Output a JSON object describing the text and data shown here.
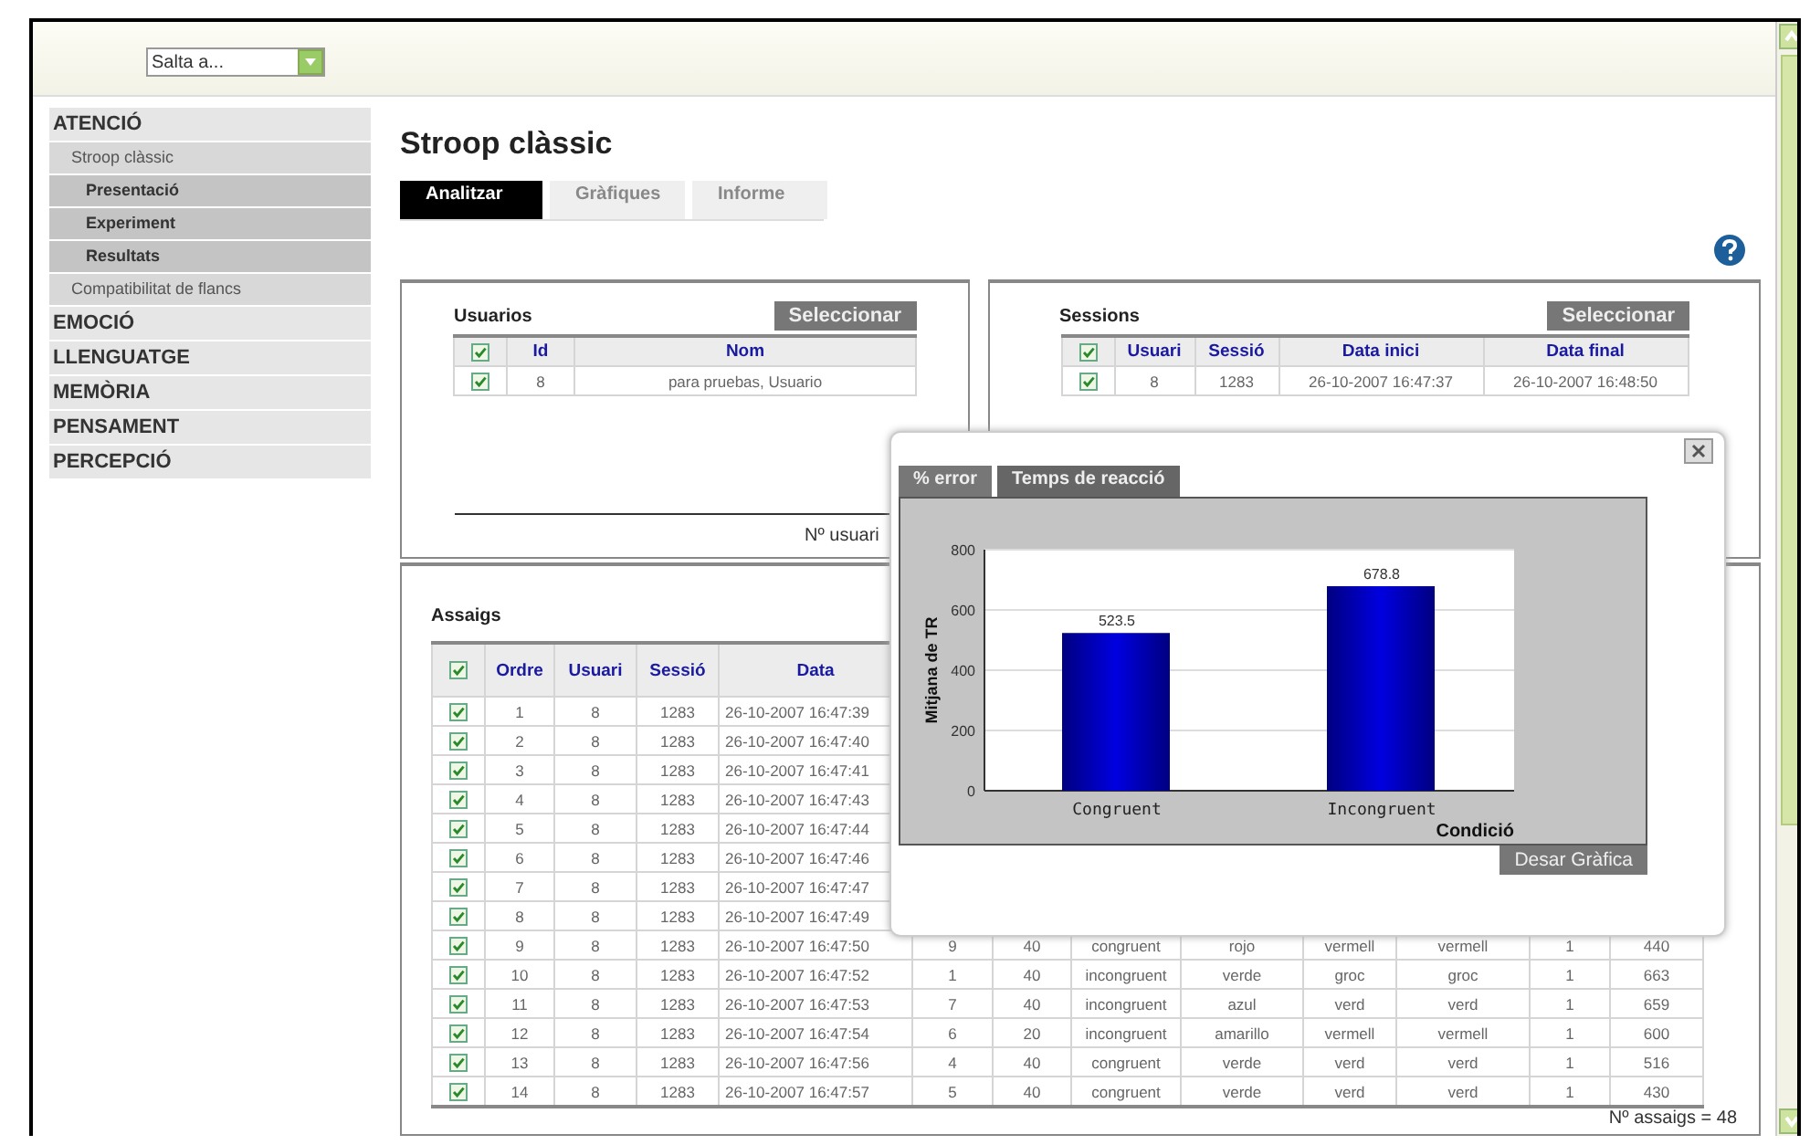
{
  "jump_select": {
    "value": "Salta a..."
  },
  "sidebar": {
    "items": [
      {
        "label": "ATENCIÓ",
        "children": [
          {
            "label": "Stroop clàssic",
            "children": [
              {
                "label": "Presentació"
              },
              {
                "label": "Experiment"
              },
              {
                "label": "Resultats"
              }
            ]
          },
          {
            "label": "Compatibilitat de flancs"
          }
        ]
      },
      {
        "label": "EMOCIÓ"
      },
      {
        "label": "LLENGUATGE"
      },
      {
        "label": "MEMÒRIA"
      },
      {
        "label": "PENSAMENT"
      },
      {
        "label": "PERCEPCIÓ"
      }
    ]
  },
  "page": {
    "title": "Stroop clàssic"
  },
  "tabs": [
    {
      "label": "Analitzar",
      "selected": true
    },
    {
      "label": "Gràfiques",
      "selected": false
    },
    {
      "label": "Informe",
      "selected": false
    }
  ],
  "users_panel": {
    "title": "Usuarios",
    "button": "Seleccionar",
    "header_checked": true,
    "columns": [
      "Id",
      "Nom"
    ],
    "rows": [
      {
        "checked": true,
        "cells": [
          "8",
          "para pruebas, Usuario"
        ]
      }
    ],
    "footer": "Nº usuari"
  },
  "sessions_panel": {
    "title": "Sessions",
    "button": "Seleccionar",
    "header_checked": true,
    "columns": [
      "Usuari",
      "Sessió",
      "Data inici",
      "Data final"
    ],
    "rows": [
      {
        "checked": true,
        "cells": [
          "8",
          "1283",
          "26-10-2007 16:47:37",
          "26-10-2007 16:48:50"
        ]
      }
    ]
  },
  "trials_panel": {
    "title": "Assaigs",
    "header_checked": true,
    "columns": [
      "Ordre",
      "Usuari",
      "Sessió",
      "Data"
    ],
    "rows": [
      {
        "checked": true,
        "cells": [
          "1",
          "8",
          "1283",
          "26-10-2007 16:47:39"
        ]
      },
      {
        "checked": true,
        "cells": [
          "2",
          "8",
          "1283",
          "26-10-2007 16:47:40"
        ]
      },
      {
        "checked": true,
        "cells": [
          "3",
          "8",
          "1283",
          "26-10-2007 16:47:41"
        ]
      },
      {
        "checked": true,
        "cells": [
          "4",
          "8",
          "1283",
          "26-10-2007 16:47:43"
        ]
      },
      {
        "checked": true,
        "cells": [
          "5",
          "8",
          "1283",
          "26-10-2007 16:47:44"
        ]
      },
      {
        "checked": true,
        "cells": [
          "6",
          "8",
          "1283",
          "26-10-2007 16:47:46"
        ]
      },
      {
        "checked": true,
        "cells": [
          "7",
          "8",
          "1283",
          "26-10-2007 16:47:47"
        ]
      },
      {
        "checked": true,
        "cells": [
          "8",
          "8",
          "1283",
          "26-10-2007 16:47:49"
        ]
      },
      {
        "checked": true,
        "cells": [
          "9",
          "8",
          "1283",
          "26-10-2007 16:47:50",
          "9",
          "40",
          "congruent",
          "rojo",
          "vermell",
          "vermell",
          "1",
          "440"
        ]
      },
      {
        "checked": true,
        "cells": [
          "10",
          "8",
          "1283",
          "26-10-2007 16:47:52",
          "1",
          "40",
          "incongruent",
          "verde",
          "groc",
          "groc",
          "1",
          "663"
        ]
      },
      {
        "checked": true,
        "cells": [
          "11",
          "8",
          "1283",
          "26-10-2007 16:47:53",
          "7",
          "40",
          "incongruent",
          "azul",
          "verd",
          "verd",
          "1",
          "659"
        ]
      },
      {
        "checked": true,
        "cells": [
          "12",
          "8",
          "1283",
          "26-10-2007 16:47:54",
          "6",
          "20",
          "incongruent",
          "amarillo",
          "vermell",
          "vermell",
          "1",
          "600"
        ]
      },
      {
        "checked": true,
        "cells": [
          "13",
          "8",
          "1283",
          "26-10-2007 16:47:56",
          "4",
          "40",
          "congruent",
          "verde",
          "verd",
          "verd",
          "1",
          "516"
        ]
      },
      {
        "checked": true,
        "cells": [
          "14",
          "8",
          "1283",
          "26-10-2007 16:47:57",
          "5",
          "40",
          "congruent",
          "verde",
          "verd",
          "verd",
          "1",
          "430"
        ]
      }
    ],
    "footer": "Nº assaigs = 48"
  },
  "chart_popup": {
    "tabs": [
      {
        "label": "% error",
        "selected": false
      },
      {
        "label": "Temps de reacció",
        "selected": true
      }
    ],
    "chart_data": {
      "type": "bar",
      "xlabel": "Condició",
      "ylabel": "Mitjana de TR",
      "categories": [
        "Congruent",
        "Incongruent"
      ],
      "values": [
        523.5,
        678.8
      ],
      "ylim": [
        0,
        800
      ],
      "yticks": [
        0,
        200,
        400,
        600,
        800
      ],
      "data_labels": true,
      "grid": true
    },
    "button": "Desar Gràfica"
  }
}
